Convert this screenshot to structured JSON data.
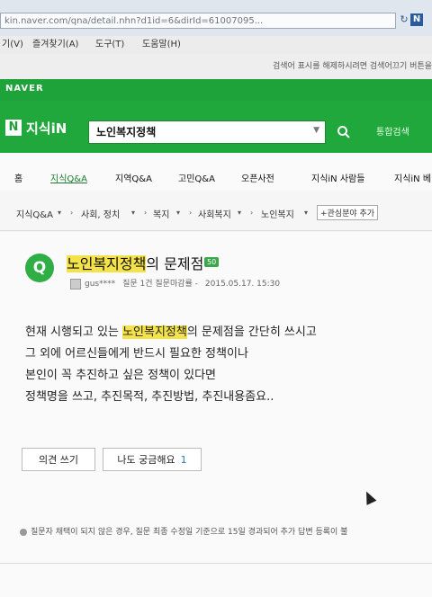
{
  "browser": {
    "url": "kin.naver.com/qna/detail.nhn?d1id=6&dirId=61007095...",
    "menu": [
      "기(V)",
      "즐겨찾기(A)",
      "도구(T)",
      "도움말(H)"
    ],
    "notice": "검색어 표시를 해제하시려면 검색어끄기 버튼을"
  },
  "naver": {
    "logo": "NAVER",
    "kin_logo_n": "N",
    "kin_logo_text": "지식iN",
    "search_value": "노인복지정책",
    "integrated_search": "통합검색"
  },
  "tabs": [
    "홈",
    "지식Q&A",
    "지역Q&A",
    "고민Q&A",
    "오픈사전",
    "지식iN 사람들",
    "지식iN 베"
  ],
  "breadcrumb": [
    "지식Q&A",
    "사회, 정치",
    "복지",
    "사회복지",
    "노인복지"
  ],
  "breadcrumb_add": "+관심분야 추가",
  "question": {
    "badge": "Q",
    "title_highlight": "노인복지정책",
    "title_rest": "의 문제점",
    "points": "50",
    "author": "gus****",
    "author_stats": "질문 1건 질문마감률 -",
    "date": "2015.05.17. 15:30",
    "body_line1_pre": "현재 시행되고 있는 ",
    "body_line1_hl": "노인복지정책",
    "body_line1_post": "의 문제점을 간단히 쓰시고",
    "body_lines": [
      "그 외에 어르신들에게 반드시 필요한 정책이나",
      "본인이 꼭 추진하고 싶은 정책이 있다면",
      "정책명을 쓰고, 추진목적, 추진방법, 추진내용좀요.."
    ],
    "answer_button": "의견 쓰기",
    "curious_button": "나도 궁금해요",
    "curious_count": "1",
    "footnote": "질문자 채택이 되지 않은 경우, 질문 최종 수정일 기준으로 15일 경과되어 추가 답변 등록이 불"
  }
}
